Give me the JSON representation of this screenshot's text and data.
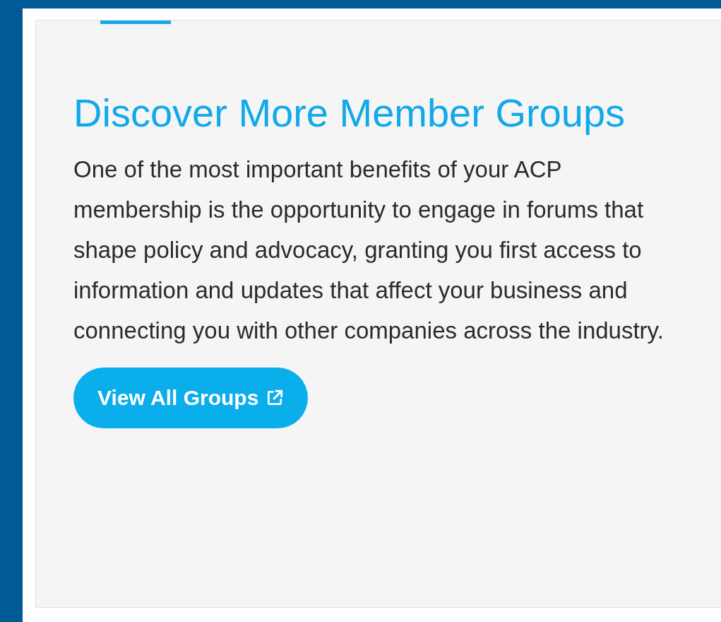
{
  "card": {
    "title": "Discover More Member Groups",
    "body": "One of the most important benefits of your ACP membership is the opportunity to engage in forums that shape policy and advocacy, granting you first access to information and updates that affect your business and connecting you with other companies across the industry.",
    "button": "View All Groups"
  }
}
